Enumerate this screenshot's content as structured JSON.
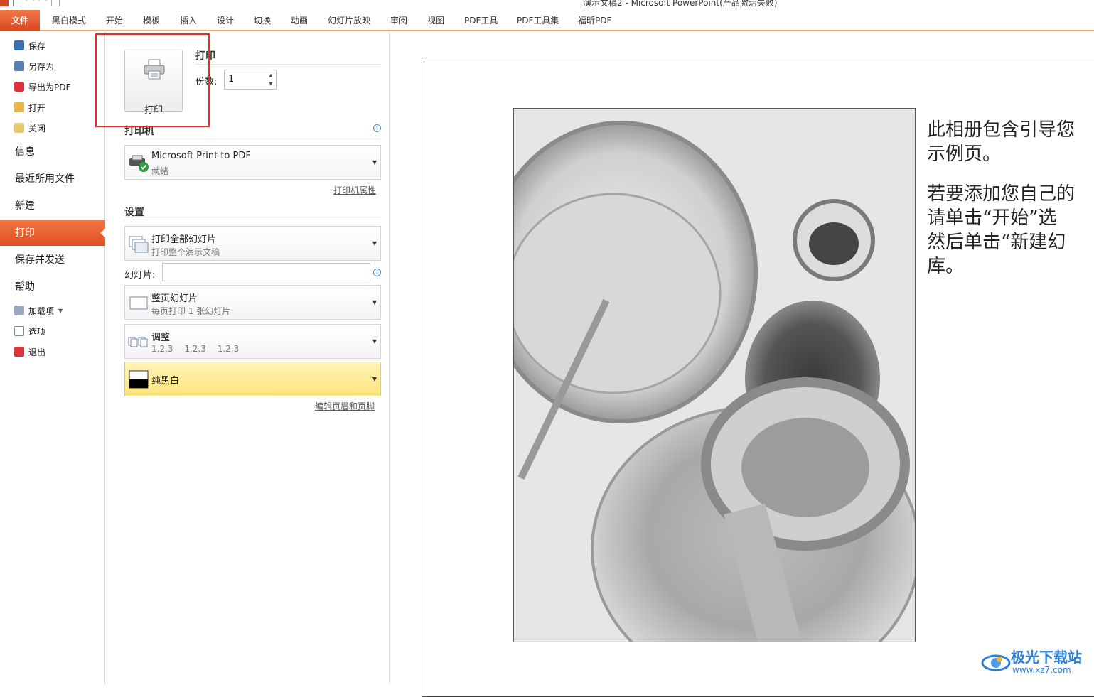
{
  "window": {
    "title": "演示文稿2 - Microsoft PowerPoint(产品激活失败)"
  },
  "ribbon": {
    "tabs": [
      "文件",
      "黑白模式",
      "开始",
      "模板",
      "插入",
      "设计",
      "切换",
      "动画",
      "幻灯片放映",
      "审阅",
      "视图",
      "PDF工具",
      "PDF工具集",
      "福昕PDF"
    ]
  },
  "nav": {
    "save": "保存",
    "save_as": "另存为",
    "export_pdf": "导出为PDF",
    "open": "打开",
    "close": "关闭",
    "info": "信息",
    "recent": "最近所用文件",
    "new": "新建",
    "print": "打印",
    "save_send": "保存并发送",
    "help": "帮助",
    "addins": "加载项",
    "options": "选项",
    "exit": "退出"
  },
  "print": {
    "button_label": "打印",
    "section_title": "打印",
    "copies_label": "份数:",
    "copies_value": "1"
  },
  "printer": {
    "section_title": "打印机",
    "name": "Microsoft Print to PDF",
    "status": "就绪",
    "properties_link": "打印机属性"
  },
  "settings": {
    "section_title": "设置",
    "range_main": "打印全部幻灯片",
    "range_sub": "打印整个演示文稿",
    "slides_label": "幻灯片:",
    "slides_value": "",
    "layout_main": "整页幻灯片",
    "layout_sub": "每页打印 1 张幻灯片",
    "collate_main": "调整",
    "collate_sub": "1,2,3 1,2,3 1,2,3",
    "color_main": "纯黑白",
    "header_footer_link": "编辑页眉和页脚"
  },
  "preview": {
    "paragraph1": "此相册包含引导您\n示例页。",
    "paragraph2": "若要添加您自己的\n请单击“开始”选\n然后单击“新建幻\n库。"
  },
  "watermark": {
    "text": "极光下载站",
    "url": "www.xz7.com"
  },
  "colors": {
    "accent": "#e0501f",
    "highlight_box": "#e0302a",
    "color_dropdown": "#fde47b"
  }
}
